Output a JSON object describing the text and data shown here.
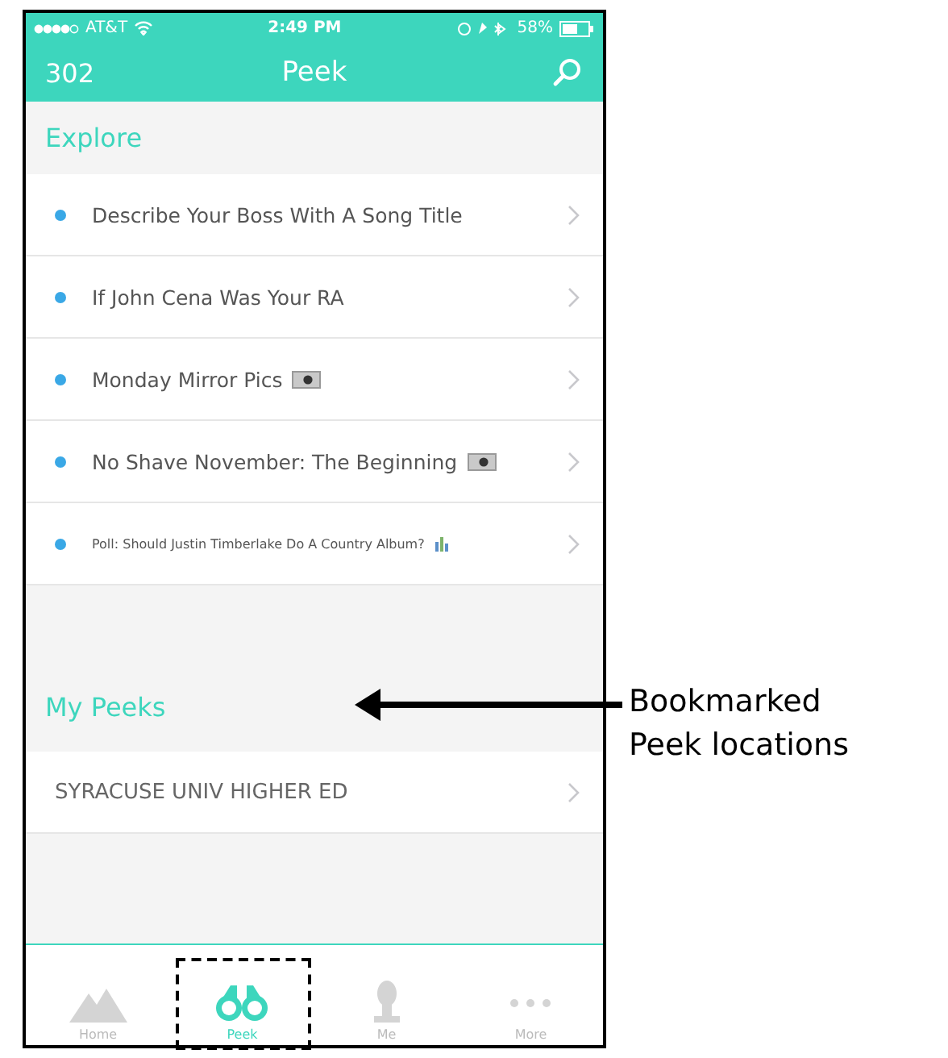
{
  "status_bar": {
    "carrier": "AT&T",
    "time": "2:49 PM",
    "battery": "58%"
  },
  "nav_bar": {
    "count": "302",
    "title": "Peek"
  },
  "sections": [
    {
      "title": "Explore",
      "items": [
        {
          "label": "Describe Your Boss With A Song Title",
          "kind": "text",
          "unread": true
        },
        {
          "label": "If John Cena Was Your RA",
          "kind": "text",
          "unread": true
        },
        {
          "label": "Monday Mirror Pics",
          "kind": "photo",
          "unread": true
        },
        {
          "label": "No Shave November: The Beginning",
          "kind": "photo",
          "unread": true
        },
        {
          "label": "Poll: Should Justin Timberlake Do A Country Album?",
          "kind": "poll",
          "unread": true
        }
      ]
    },
    {
      "title": "My Peeks",
      "items": [
        {
          "label": "SYRACUSE UNIV HIGHER ED",
          "kind": "location",
          "unread": false
        }
      ]
    }
  ],
  "tabs": [
    {
      "label": "Home",
      "kind": "home",
      "selected": false
    },
    {
      "label": "Peek",
      "kind": "peek",
      "selected": true
    },
    {
      "label": "Me",
      "kind": "me",
      "selected": false
    },
    {
      "label": "More",
      "kind": "more",
      "selected": false
    }
  ],
  "annotation": {
    "lines": [
      "Bookmarked",
      "Peek locations"
    ]
  }
}
